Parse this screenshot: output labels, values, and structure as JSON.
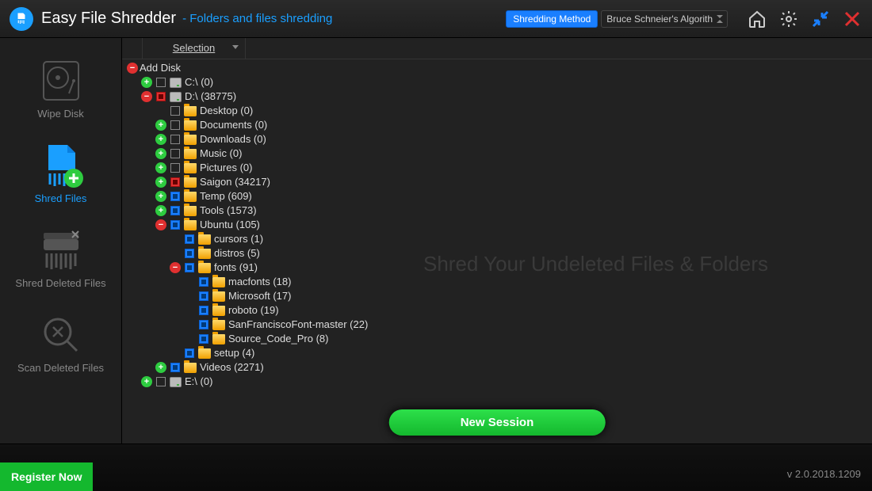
{
  "header": {
    "title": "Easy File Shredder",
    "subtitle": "- Folders and files shredding",
    "method_badge": "Shredding Method",
    "method_value": "Bruce Schneier's Algorith"
  },
  "sidebar": {
    "wipe_disk": "Wipe Disk",
    "shred_files": "Shred Files",
    "shred_deleted": "Shred Deleted Files",
    "scan_deleted": "Scan Deleted Files"
  },
  "panel": {
    "selection_header": "Selection",
    "watermark": "Shred Your Undeleted Files & Folders",
    "new_session": "New Session"
  },
  "tree": {
    "root": "Add Disk",
    "nodes": [
      {
        "indent": 0,
        "exp": "minus",
        "cb": "",
        "icon": "",
        "label": "Add Disk"
      },
      {
        "indent": 1,
        "exp": "plus",
        "cb": "empty",
        "icon": "drv",
        "label": "C:\\ (0)"
      },
      {
        "indent": 1,
        "exp": "minus",
        "cb": "red",
        "icon": "drv",
        "label": "D:\\ (38775)"
      },
      {
        "indent": 2,
        "exp": "none",
        "cb": "empty",
        "icon": "fld",
        "label": "Desktop (0)"
      },
      {
        "indent": 2,
        "exp": "plus",
        "cb": "empty",
        "icon": "fld",
        "label": "Documents (0)"
      },
      {
        "indent": 2,
        "exp": "plus",
        "cb": "empty",
        "icon": "fld",
        "label": "Downloads (0)"
      },
      {
        "indent": 2,
        "exp": "plus",
        "cb": "empty",
        "icon": "fld",
        "label": "Music (0)"
      },
      {
        "indent": 2,
        "exp": "plus",
        "cb": "empty",
        "icon": "fld",
        "label": "Pictures (0)"
      },
      {
        "indent": 2,
        "exp": "plus",
        "cb": "red",
        "icon": "fld",
        "label": "Saigon (34217)"
      },
      {
        "indent": 2,
        "exp": "plus",
        "cb": "blue",
        "icon": "fld",
        "label": "Temp (609)"
      },
      {
        "indent": 2,
        "exp": "plus",
        "cb": "blue",
        "icon": "fld",
        "label": "Tools (1573)"
      },
      {
        "indent": 2,
        "exp": "minus",
        "cb": "blue",
        "icon": "fld",
        "label": "Ubuntu (105)"
      },
      {
        "indent": 3,
        "exp": "none",
        "cb": "blue",
        "icon": "fld",
        "label": "cursors (1)"
      },
      {
        "indent": 3,
        "exp": "none",
        "cb": "blue",
        "icon": "fld",
        "label": "distros (5)"
      },
      {
        "indent": 3,
        "exp": "minus",
        "cb": "blue",
        "icon": "fld",
        "label": "fonts (91)"
      },
      {
        "indent": 4,
        "exp": "none",
        "cb": "blue",
        "icon": "fld",
        "label": "macfonts (18)"
      },
      {
        "indent": 4,
        "exp": "none",
        "cb": "blue",
        "icon": "fld",
        "label": "Microsoft (17)"
      },
      {
        "indent": 4,
        "exp": "none",
        "cb": "blue",
        "icon": "fld",
        "label": "roboto (19)"
      },
      {
        "indent": 4,
        "exp": "none",
        "cb": "blue",
        "icon": "fld",
        "label": "SanFranciscoFont-master (22)"
      },
      {
        "indent": 4,
        "exp": "none",
        "cb": "blue",
        "icon": "fld",
        "label": "Source_Code_Pro (8)"
      },
      {
        "indent": 3,
        "exp": "none",
        "cb": "blue",
        "icon": "fld",
        "label": "setup (4)"
      },
      {
        "indent": 2,
        "exp": "plus",
        "cb": "blue",
        "icon": "fld",
        "label": "Videos (2271)"
      },
      {
        "indent": 1,
        "exp": "plus",
        "cb": "empty",
        "icon": "drv",
        "label": "E:\\ (0)"
      }
    ]
  },
  "footer": {
    "register": "Register Now",
    "version": "v 2.0.2018.1209"
  }
}
